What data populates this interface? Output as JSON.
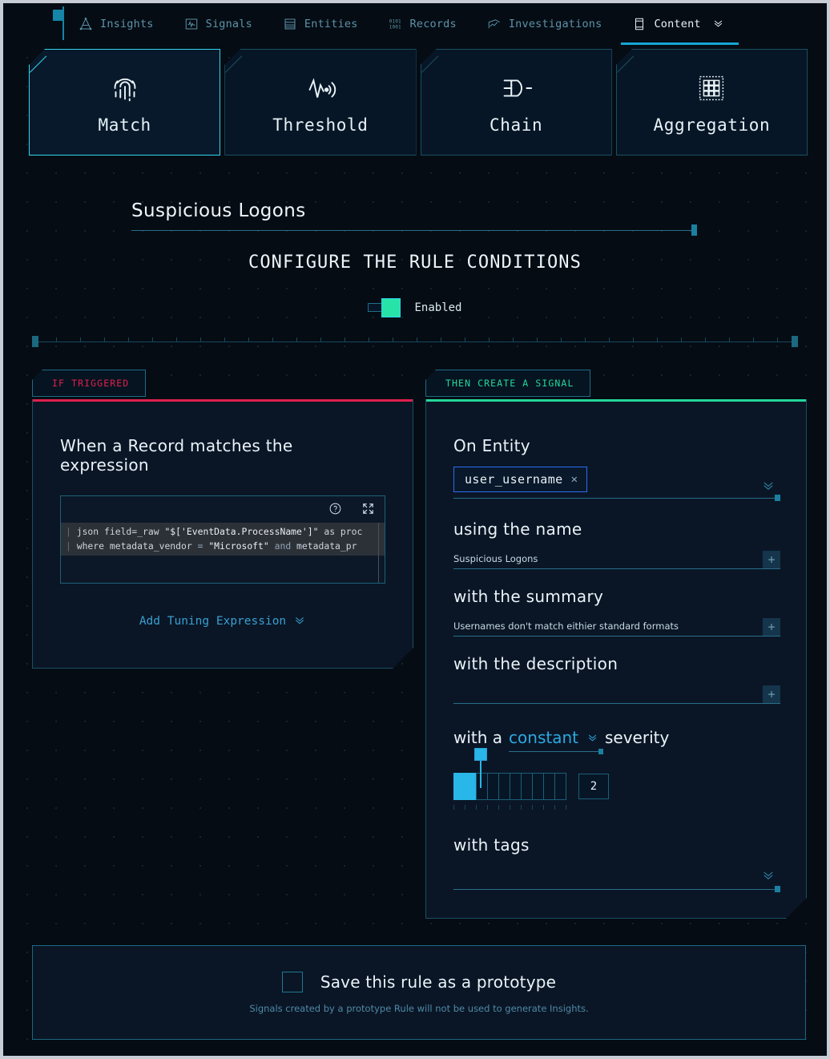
{
  "nav": {
    "items": [
      {
        "label": "Insights",
        "icon": "insights-icon",
        "active": false
      },
      {
        "label": "Signals",
        "icon": "signals-icon",
        "active": false
      },
      {
        "label": "Entities",
        "icon": "entities-icon",
        "active": false
      },
      {
        "label": "Records",
        "icon": "records-icon",
        "active": false
      },
      {
        "label": "Investigations",
        "icon": "investigations-icon",
        "active": false
      },
      {
        "label": "Content",
        "icon": "content-icon",
        "active": true
      }
    ]
  },
  "rule_types": [
    {
      "label": "Match",
      "icon": "fingerprint-icon",
      "selected": true
    },
    {
      "label": "Threshold",
      "icon": "waveform-signal-icon",
      "selected": false
    },
    {
      "label": "Chain",
      "icon": "logic-gate-icon",
      "selected": false
    },
    {
      "label": "Aggregation",
      "icon": "grid-matrix-icon",
      "selected": false
    }
  ],
  "rule": {
    "title": "Suspicious Logons",
    "configure_heading": "CONFIGURE THE RULE CONDITIONS",
    "enabled_label": "Enabled",
    "enabled": true
  },
  "if_panel": {
    "tag": "IF TRIGGERED",
    "accent": "#e01f4d",
    "heading": "When a Record matches the expression",
    "editor": {
      "help_icon": "help-circle-icon",
      "expand_icon": "expand-fullscreen-icon",
      "lines": [
        {
          "gutter": "|",
          "segments": [
            {
              "t": " json field=_raw ",
              "c": "plain"
            },
            {
              "t": "\"$['EventData.ProcessName']\"",
              "c": "str"
            },
            {
              "t": " as proc",
              "c": "plain"
            }
          ]
        },
        {
          "gutter": "|",
          "segments": [
            {
              "t": " where metadata_vendor ",
              "c": "plain"
            },
            {
              "t": "=",
              "c": "op"
            },
            {
              "t": " ",
              "c": "plain"
            },
            {
              "t": "\"Microsoft\"",
              "c": "str"
            },
            {
              "t": " ",
              "c": "plain"
            },
            {
              "t": "and",
              "c": "kw"
            },
            {
              "t": " metadata_pr",
              "c": "plain"
            }
          ]
        }
      ]
    },
    "add_tuning_label": "Add Tuning Expression"
  },
  "then_panel": {
    "tag": "THEN CREATE A SIGNAL",
    "accent": "#24d79a",
    "on_entity": {
      "label": "On Entity",
      "chip_value": "user_username",
      "remove_icon": "close-x-icon",
      "chevron_icon": "chevron-down-icon"
    },
    "name": {
      "label": "using the name",
      "value": "Suspicious Logons",
      "add_icon": "plus-icon"
    },
    "summary": {
      "label": "with the summary",
      "value": "Usernames don't match eithier standard formats",
      "add_icon": "plus-icon"
    },
    "description": {
      "label": "with the description",
      "value": "",
      "add_icon": "plus-icon"
    },
    "severity": {
      "prefix": "with a",
      "mode": "constant",
      "suffix": "severity",
      "value": "2",
      "segments_total": 10,
      "segments_filled": 2,
      "chevron_icon": "chevron-down-icon"
    },
    "tags": {
      "label": "with tags",
      "value": "",
      "chevron_icon": "chevron-down-icon"
    }
  },
  "prototype": {
    "checkbox_label": "Save this rule as a prototype",
    "checked": false,
    "note": "Signals created by a prototype Rule will not be used to generate Insights."
  },
  "colors": {
    "background": "#050c14",
    "panel": "#0a1626",
    "accent_cyan": "#2fd6ee",
    "accent_blue": "#29b6e8",
    "accent_green": "#24d79a",
    "accent_red": "#e01f4d",
    "border": "#1b4f64"
  }
}
